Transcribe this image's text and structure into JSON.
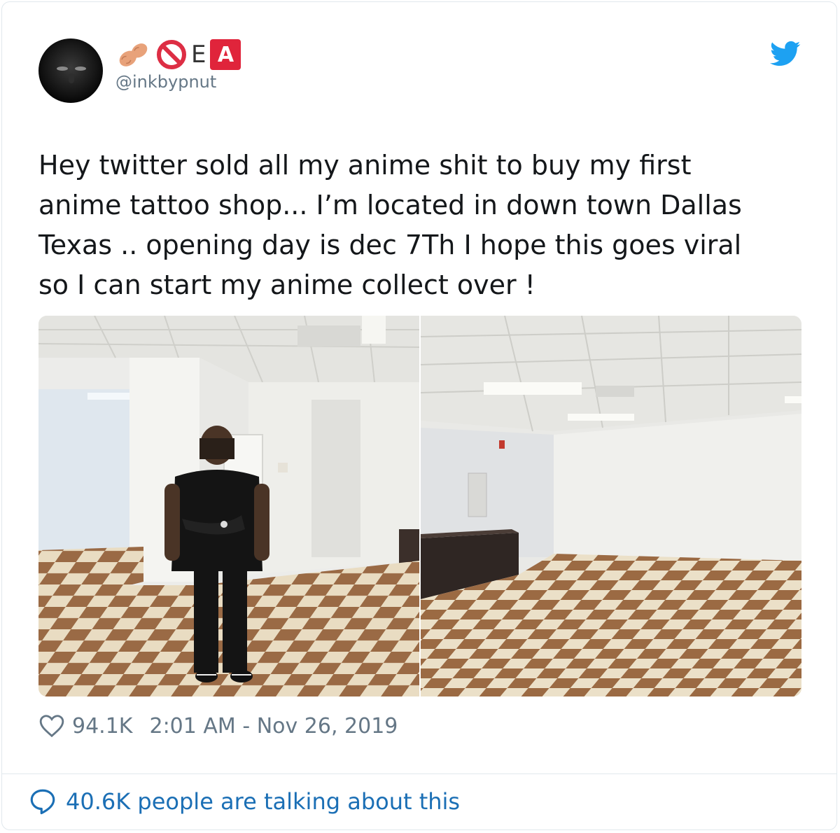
{
  "author": {
    "display_name_letters": [
      "E",
      "A"
    ],
    "handle": "@inkbypnut"
  },
  "tweet": {
    "text": "Hey twitter sold all my anime shit to buy my first\nanime tattoo shop... I’m located in down town Dallas\nTexas .. opening day is dec 7Th I hope this goes viral\nso I can start my anime collect over !"
  },
  "footer": {
    "likes": "94.1K",
    "timestamp": "2:01 AM - Nov 26, 2019",
    "talking": "40.6K people are talking about this"
  },
  "icons": {
    "avatar": "avatar-image",
    "name_emoji_1": "peanut-icon",
    "name_emoji_2": "no-entry-icon",
    "brand": "twitter-bird-icon",
    "like": "heart-icon",
    "reply": "speech-bubble-icon"
  },
  "colors": {
    "text": "#14171a",
    "secondary": "#657786",
    "twitter_blue": "#1da1f2",
    "link_blue": "#1b6fb5",
    "badge_red": "#e0243b"
  }
}
